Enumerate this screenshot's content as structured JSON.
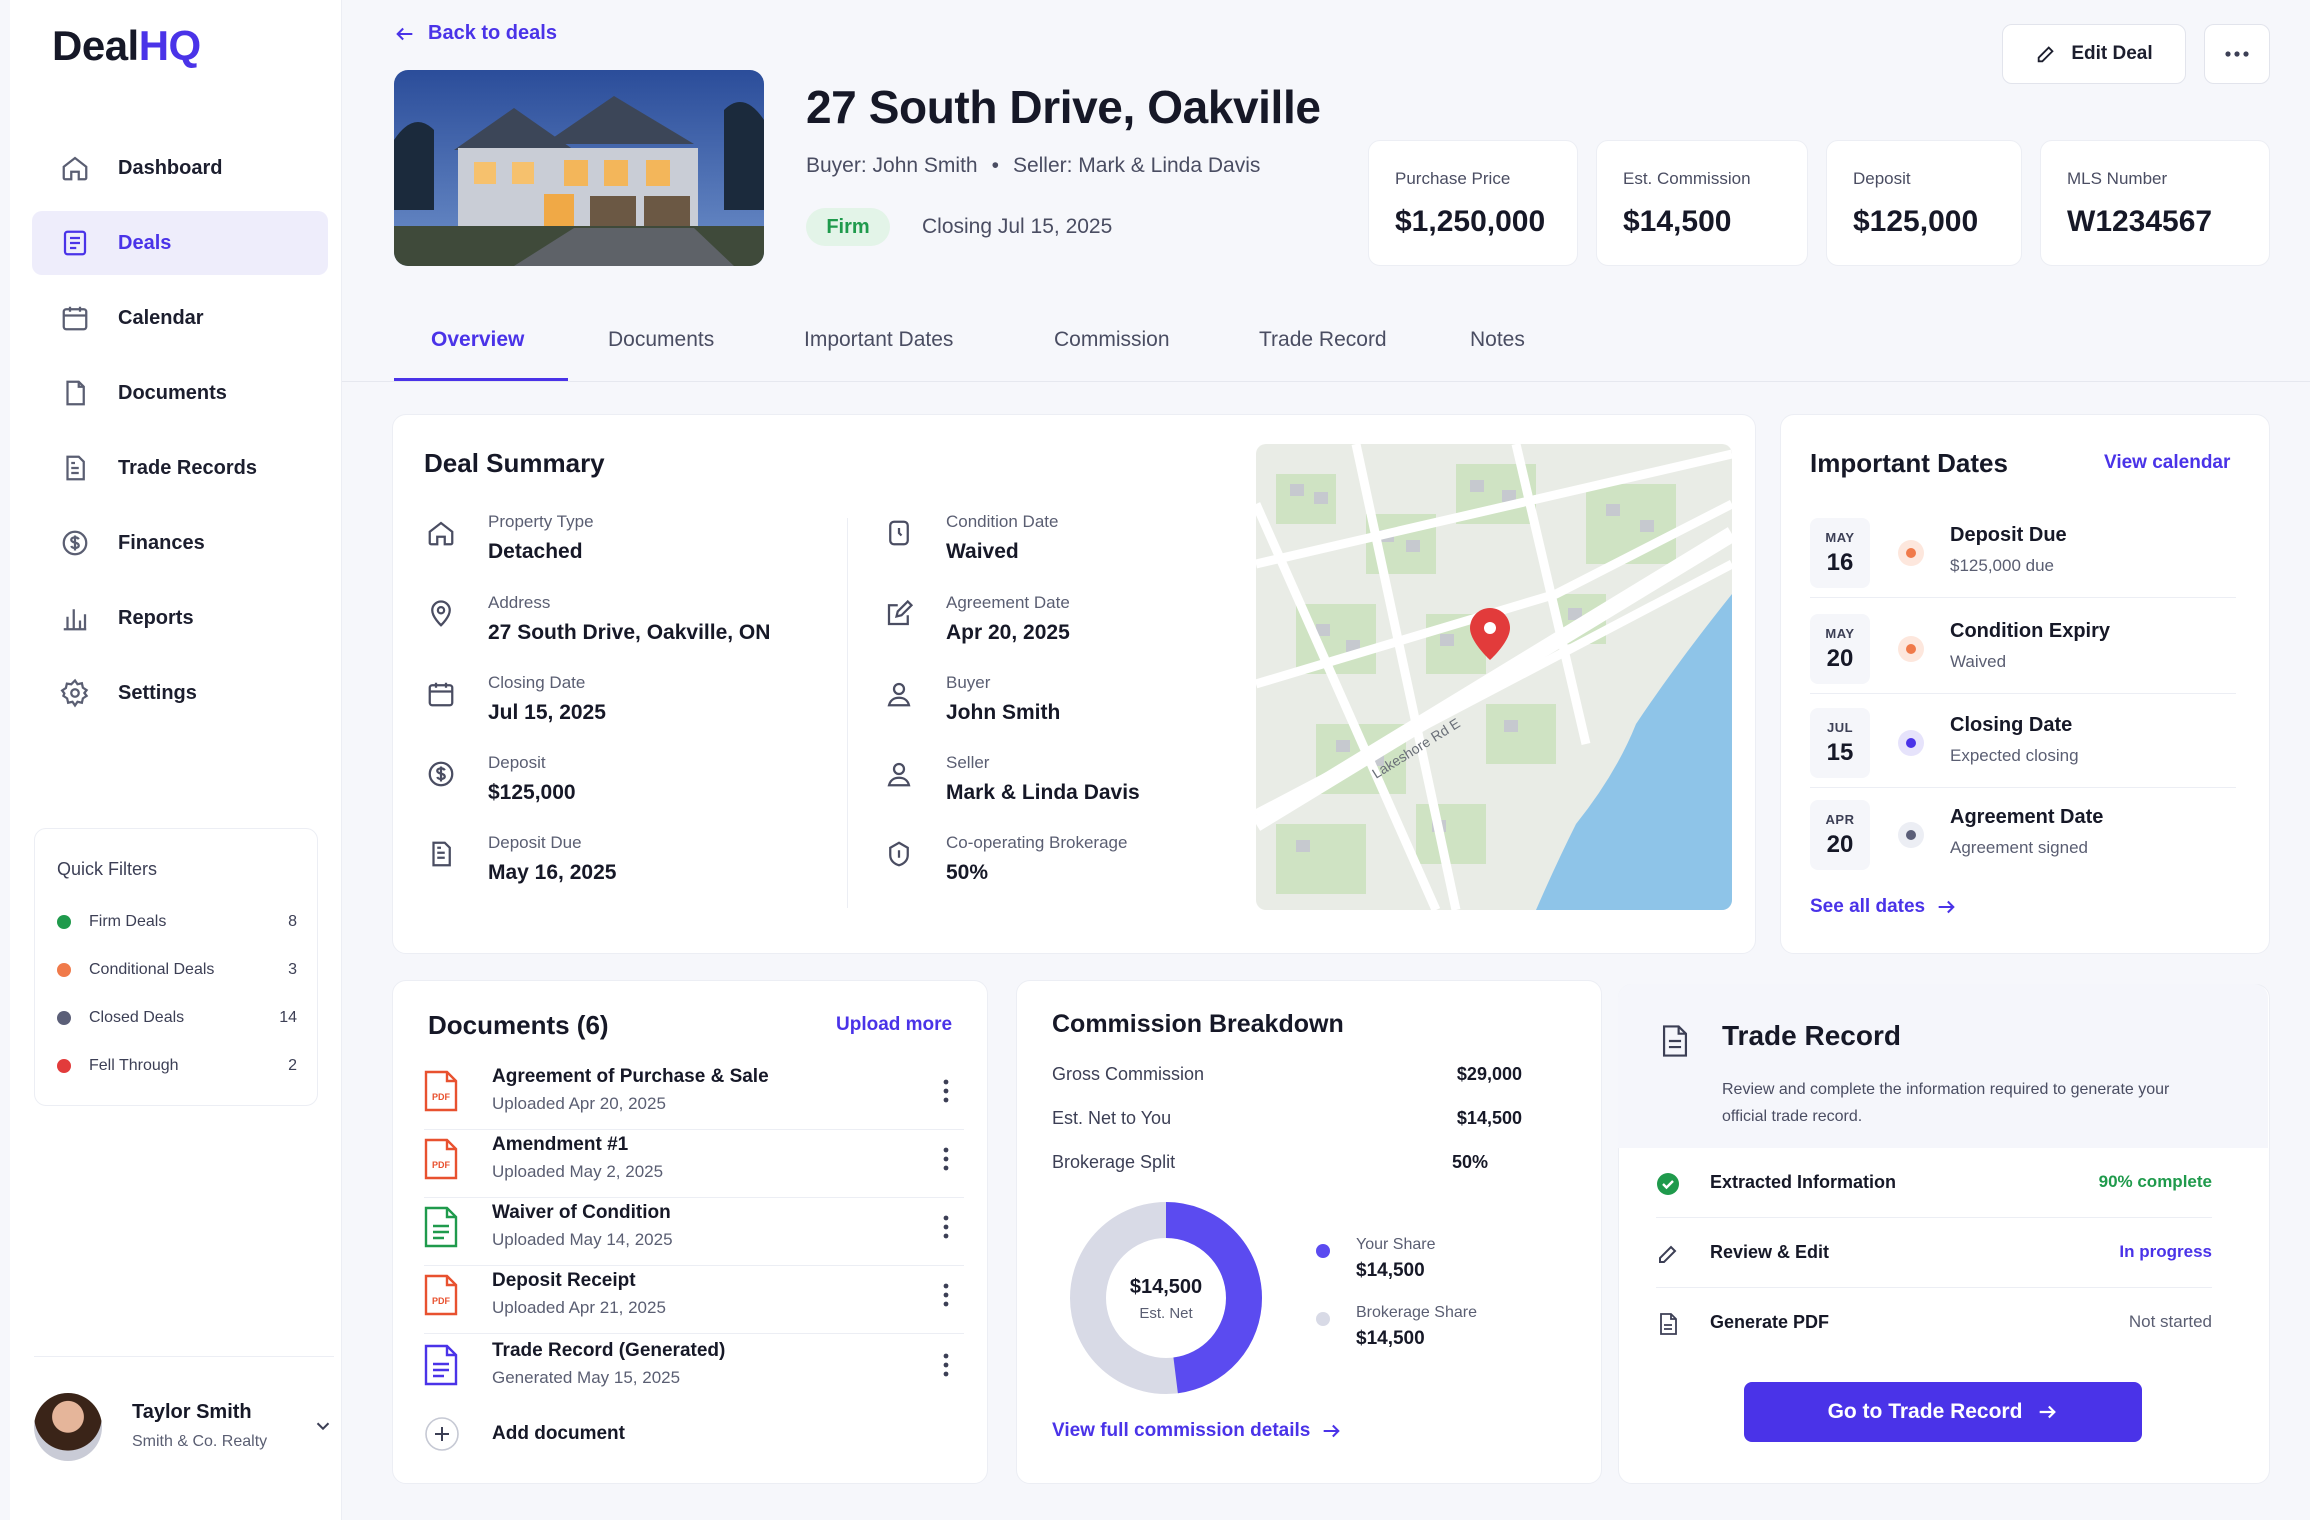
{
  "brand": {
    "name_a": "Deal",
    "name_b": "HQ",
    "accent": "#4a33e8"
  },
  "sidebar": {
    "nav": [
      {
        "label": "Dashboard",
        "icon": "home-icon",
        "active": false
      },
      {
        "label": "Deals",
        "icon": "file-list-icon",
        "active": true
      },
      {
        "label": "Calendar",
        "icon": "calendar-icon",
        "active": false
      },
      {
        "label": "Documents",
        "icon": "document-icon",
        "active": false
      },
      {
        "label": "Trade Records",
        "icon": "trade-record-icon",
        "active": false
      },
      {
        "label": "Finances",
        "icon": "dollar-icon",
        "active": false
      },
      {
        "label": "Reports",
        "icon": "bar-chart-icon",
        "active": false
      },
      {
        "label": "Settings",
        "icon": "gear-icon",
        "active": false
      }
    ],
    "quick_filters": {
      "title": "Quick Filters",
      "items": [
        {
          "label": "Firm Deals",
          "count": "8",
          "color": "#1f9a4c"
        },
        {
          "label": "Conditional Deals",
          "count": "3",
          "color": "#f07a4a"
        },
        {
          "label": "Closed Deals",
          "count": "14",
          "color": "#5b5f78"
        },
        {
          "label": "Fell Through",
          "count": "2",
          "color": "#e23b3b"
        }
      ]
    },
    "user": {
      "name": "Taylor Smith",
      "company": "Smith & Co. Realty"
    }
  },
  "header": {
    "back_label": "Back to deals",
    "title": "27 South Drive, Oakville",
    "buyer": "Buyer: John Smith",
    "separator": "•",
    "seller": "Seller: Mark & Linda Davis",
    "status": "Firm",
    "closing": "Closing Jul 15, 2025",
    "edit_label": "Edit Deal",
    "stats": [
      {
        "label": "Purchase Price",
        "value": "$1,250,000"
      },
      {
        "label": "Est. Commission",
        "value": "$14,500"
      },
      {
        "label": "Deposit",
        "value": "$125,000"
      },
      {
        "label": "MLS Number",
        "value": "W1234567"
      }
    ]
  },
  "tabs": [
    "Overview",
    "Documents",
    "Important Dates",
    "Commission",
    "Trade Record",
    "Notes"
  ],
  "deal_summary": {
    "title": "Deal Summary",
    "left": [
      {
        "label": "Property Type",
        "value": "Detached",
        "icon": "home-icon"
      },
      {
        "label": "Address",
        "value": "27 South Drive, Oakville, ON",
        "icon": "location-pin-icon"
      },
      {
        "label": "Closing Date",
        "value": "Jul 15, 2025",
        "icon": "calendar-icon"
      },
      {
        "label": "Deposit",
        "value": "$125,000",
        "icon": "dollar-icon"
      },
      {
        "label": "Deposit Due",
        "value": "May 16, 2025",
        "icon": "receipt-icon"
      }
    ],
    "right": [
      {
        "label": "Condition Date",
        "value": "Waived",
        "icon": "clock-icon"
      },
      {
        "label": "Agreement Date",
        "value": "Apr 20, 2025",
        "icon": "edit-doc-icon"
      },
      {
        "label": "Buyer",
        "value": "John Smith",
        "icon": "person-icon"
      },
      {
        "label": "Seller",
        "value": "Mark & Linda Davis",
        "icon": "person-icon"
      },
      {
        "label": "Co-operating Brokerage",
        "value": "50%",
        "icon": "badge-icon"
      }
    ],
    "map_labels": [
      "Lakeshore Rd E"
    ]
  },
  "important_dates": {
    "title": "Important Dates",
    "link": "View calendar",
    "items": [
      {
        "mon": "MAY",
        "day": "16",
        "name": "Deposit Due",
        "sub": "$125,000 due",
        "color": "#f07a4a"
      },
      {
        "mon": "MAY",
        "day": "20",
        "name": "Condition Expiry",
        "sub": "Waived",
        "color": "#f07a4a"
      },
      {
        "mon": "JUL",
        "day": "15",
        "name": "Closing Date",
        "sub": "Expected closing",
        "color": "#4a33e8"
      },
      {
        "mon": "APR",
        "day": "20",
        "name": "Agreement Date",
        "sub": "Agreement signed",
        "color": "#5b5f78"
      }
    ],
    "see_all": "See all dates"
  },
  "documents": {
    "title": "Documents (6)",
    "link": "Upload more",
    "items": [
      {
        "name": "Agreement of Purchase & Sale",
        "sub": "Uploaded Apr 20, 2025",
        "type": "pdf"
      },
      {
        "name": "Amendment #1",
        "sub": "Uploaded May 2, 2025",
        "type": "pdf"
      },
      {
        "name": "Waiver of Condition",
        "sub": "Uploaded May 14, 2025",
        "type": "sheet"
      },
      {
        "name": "Deposit Receipt",
        "sub": "Uploaded Apr 21, 2025",
        "type": "pdf"
      },
      {
        "name": "Trade Record (Generated)",
        "sub": "Generated May 15, 2025",
        "type": "doc"
      }
    ],
    "add_label": "Add document",
    "pdf_tag": "PDF"
  },
  "commission": {
    "title": "Commission Breakdown",
    "rows": [
      {
        "label": "Gross Commission",
        "value": "$29,000"
      },
      {
        "label": "Est. Net to You",
        "value": "$14,500"
      },
      {
        "label": "Brokerage Split",
        "value": "50%"
      }
    ],
    "donut_value": "$14,500",
    "donut_label": "Est. Net",
    "share_fraction": 0.48,
    "legend": [
      {
        "name": "Your Share",
        "value": "$14,500",
        "color": "#5b4bf0"
      },
      {
        "name": "Brokerage Share",
        "value": "$14,500",
        "color": "#d8dae6"
      }
    ],
    "link": "View full commission details"
  },
  "trade_record": {
    "title": "Trade Record",
    "desc_1": "Review and complete the information required to generate your",
    "desc_2": "official trade record.",
    "steps": [
      {
        "name": "Extracted Information",
        "status": "90% complete",
        "color": "#1f9a4c",
        "icon": "check-circle-icon"
      },
      {
        "name": "Review & Edit",
        "status": "In progress",
        "color": "#4a33e8",
        "icon": "pencil-icon"
      },
      {
        "name": "Generate PDF",
        "status": "Not started",
        "color": "#5a5e72",
        "icon": "document-icon"
      }
    ],
    "button": "Go to Trade Record"
  }
}
